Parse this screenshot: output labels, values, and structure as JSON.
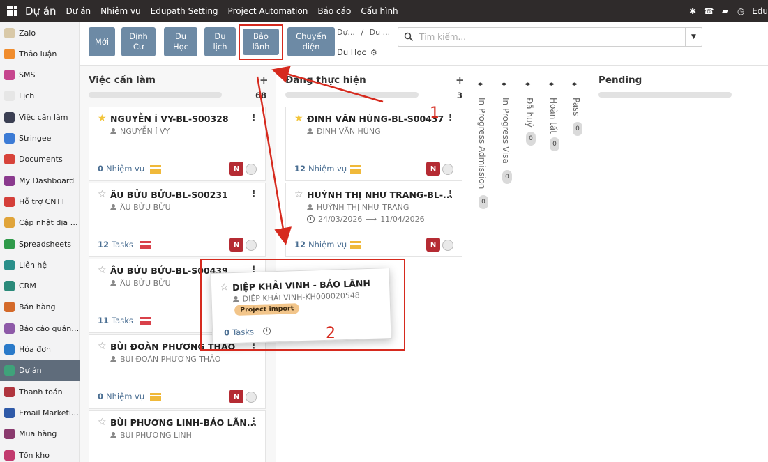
{
  "topbar": {
    "brand": "Dự án",
    "menu": [
      "Dự án",
      "Nhiệm vụ",
      "Edupath Setting",
      "Project Automation",
      "Báo cáo",
      "Cấu hình"
    ],
    "user": "Edu"
  },
  "sidebar": {
    "items": [
      {
        "label": "Zalo",
        "color": "#d9c9a8"
      },
      {
        "label": "Thảo luận",
        "color": "#f08c2d"
      },
      {
        "label": "SMS",
        "color": "#c6458e"
      },
      {
        "label": "Lịch",
        "color": "#e6e6e6"
      },
      {
        "label": "Việc cần làm",
        "color": "#3b3f53"
      },
      {
        "label": "Stringee",
        "color": "#3c7bd5"
      },
      {
        "label": "Documents",
        "color": "#d7433a"
      },
      {
        "label": "My Dashboard",
        "color": "#8a3a8e"
      },
      {
        "label": "Hỗ trợ CNTT",
        "color": "#d43f3a"
      },
      {
        "label": "Cập nhật địa c...",
        "color": "#e0a43a"
      },
      {
        "label": "Spreadsheets",
        "color": "#2f9a4a"
      },
      {
        "label": "Liên hệ",
        "color": "#2a8f8a"
      },
      {
        "label": "CRM",
        "color": "#2b8a7a"
      },
      {
        "label": "Bán hàng",
        "color": "#d46a2a"
      },
      {
        "label": "Báo cáo quản ...",
        "color": "#8e5aa8"
      },
      {
        "label": "Hóa đơn",
        "color": "#2a7ac9"
      },
      {
        "label": "Dự án",
        "color": "#3fa27a"
      },
      {
        "label": "Thanh toán",
        "color": "#b0353e"
      },
      {
        "label": "Email Marketing",
        "color": "#2f5aa8"
      },
      {
        "label": "Mua hàng",
        "color": "#8a3a6e"
      },
      {
        "label": "Tồn kho",
        "color": "#c23a6e"
      }
    ]
  },
  "buttons": {
    "new": "Mới",
    "dinhcu": "Định\nCư",
    "duhoc": "Du\nHọc",
    "dulich": "Du\nlịch",
    "baolanh": "Bảo\nlãnh",
    "chuyendien": "Chuyển\ndiện"
  },
  "breadcrumb": {
    "part1": "Dự...",
    "sep": "/",
    "part2": "Du ...",
    "current": "Du Học"
  },
  "search": {
    "placeholder": "Tìm kiếm..."
  },
  "columns": {
    "todo": {
      "title": "Việc cần làm",
      "count": "68",
      "cards": [
        {
          "title": "NGUYỄN Í VY-BL-S00328",
          "sub": "NGUYỄN Í VY",
          "tasks_num": "0",
          "tasks_lbl": "Nhiệm vụ",
          "badge": "N",
          "starred": true
        },
        {
          "title": "ÂU BỬU BỬU-BL-S00231",
          "sub": "ÂU BỬU BỬU",
          "tasks_num": "12",
          "tasks_lbl": "Tasks",
          "badge": "N",
          "starred": false
        },
        {
          "title": "ÂU BỬU BỬU-BL-S00439",
          "sub": "ÂU BỬU BỬU",
          "tasks_num": "11",
          "tasks_lbl": "Tasks",
          "badge": "",
          "starred": false
        },
        {
          "title": "BÙI ĐOÀN PHƯƠNG THẢO",
          "sub": "BÙI ĐOÀN PHƯƠNG THẢO",
          "tasks_num": "0",
          "tasks_lbl": "Nhiệm vụ",
          "badge": "N",
          "starred": false
        },
        {
          "title": "BÙI PHƯƠNG LINH-BẢO LÃN...",
          "sub": "BÙI PHƯƠNG LINH",
          "starred": false
        }
      ]
    },
    "inprogress": {
      "title": "Đang thực hiện",
      "count": "3",
      "cards": [
        {
          "title": "ĐINH VĂN HÙNG-BL-S00437",
          "sub": "ĐINH VĂN HÙNG",
          "tasks_num": "12",
          "tasks_lbl": "Nhiệm vụ",
          "badge": "N",
          "starred": true
        },
        {
          "title": "HUỲNH THỊ NHƯ TRANG-BL-...",
          "sub": "HUỲNH THỊ NHƯ TRANG",
          "date_start": "24/03/2026",
          "date_end": "11/04/2026",
          "tasks_num": "12",
          "tasks_lbl": "Nhiệm vụ",
          "badge": "N",
          "starred": false
        }
      ]
    },
    "folded": [
      {
        "label": "In Progress Admission",
        "count": "0"
      },
      {
        "label": "In Progress Visa",
        "count": "0"
      },
      {
        "label": "Đã huỷ",
        "count": "0"
      },
      {
        "label": "Hoàn tất",
        "count": "0"
      },
      {
        "label": "Pass",
        "count": "0"
      }
    ],
    "pending": {
      "title": "Pending"
    }
  },
  "dragged_card": {
    "title": "DIỆP KHẢI VINH - BẢO LÃNH",
    "sub": "DIỆP KHẢI VINH-KH000020548",
    "tag": "Project import",
    "tasks_num": "0",
    "tasks_lbl": "Tasks"
  },
  "annotations": {
    "one": "1",
    "two": "2"
  },
  "colors": {
    "topbar": "#2f2b2b",
    "button": "#6d8aa5",
    "annotation_red": "#d62a1e",
    "badge_red": "#b52b33",
    "tag": "#f2c58a"
  }
}
